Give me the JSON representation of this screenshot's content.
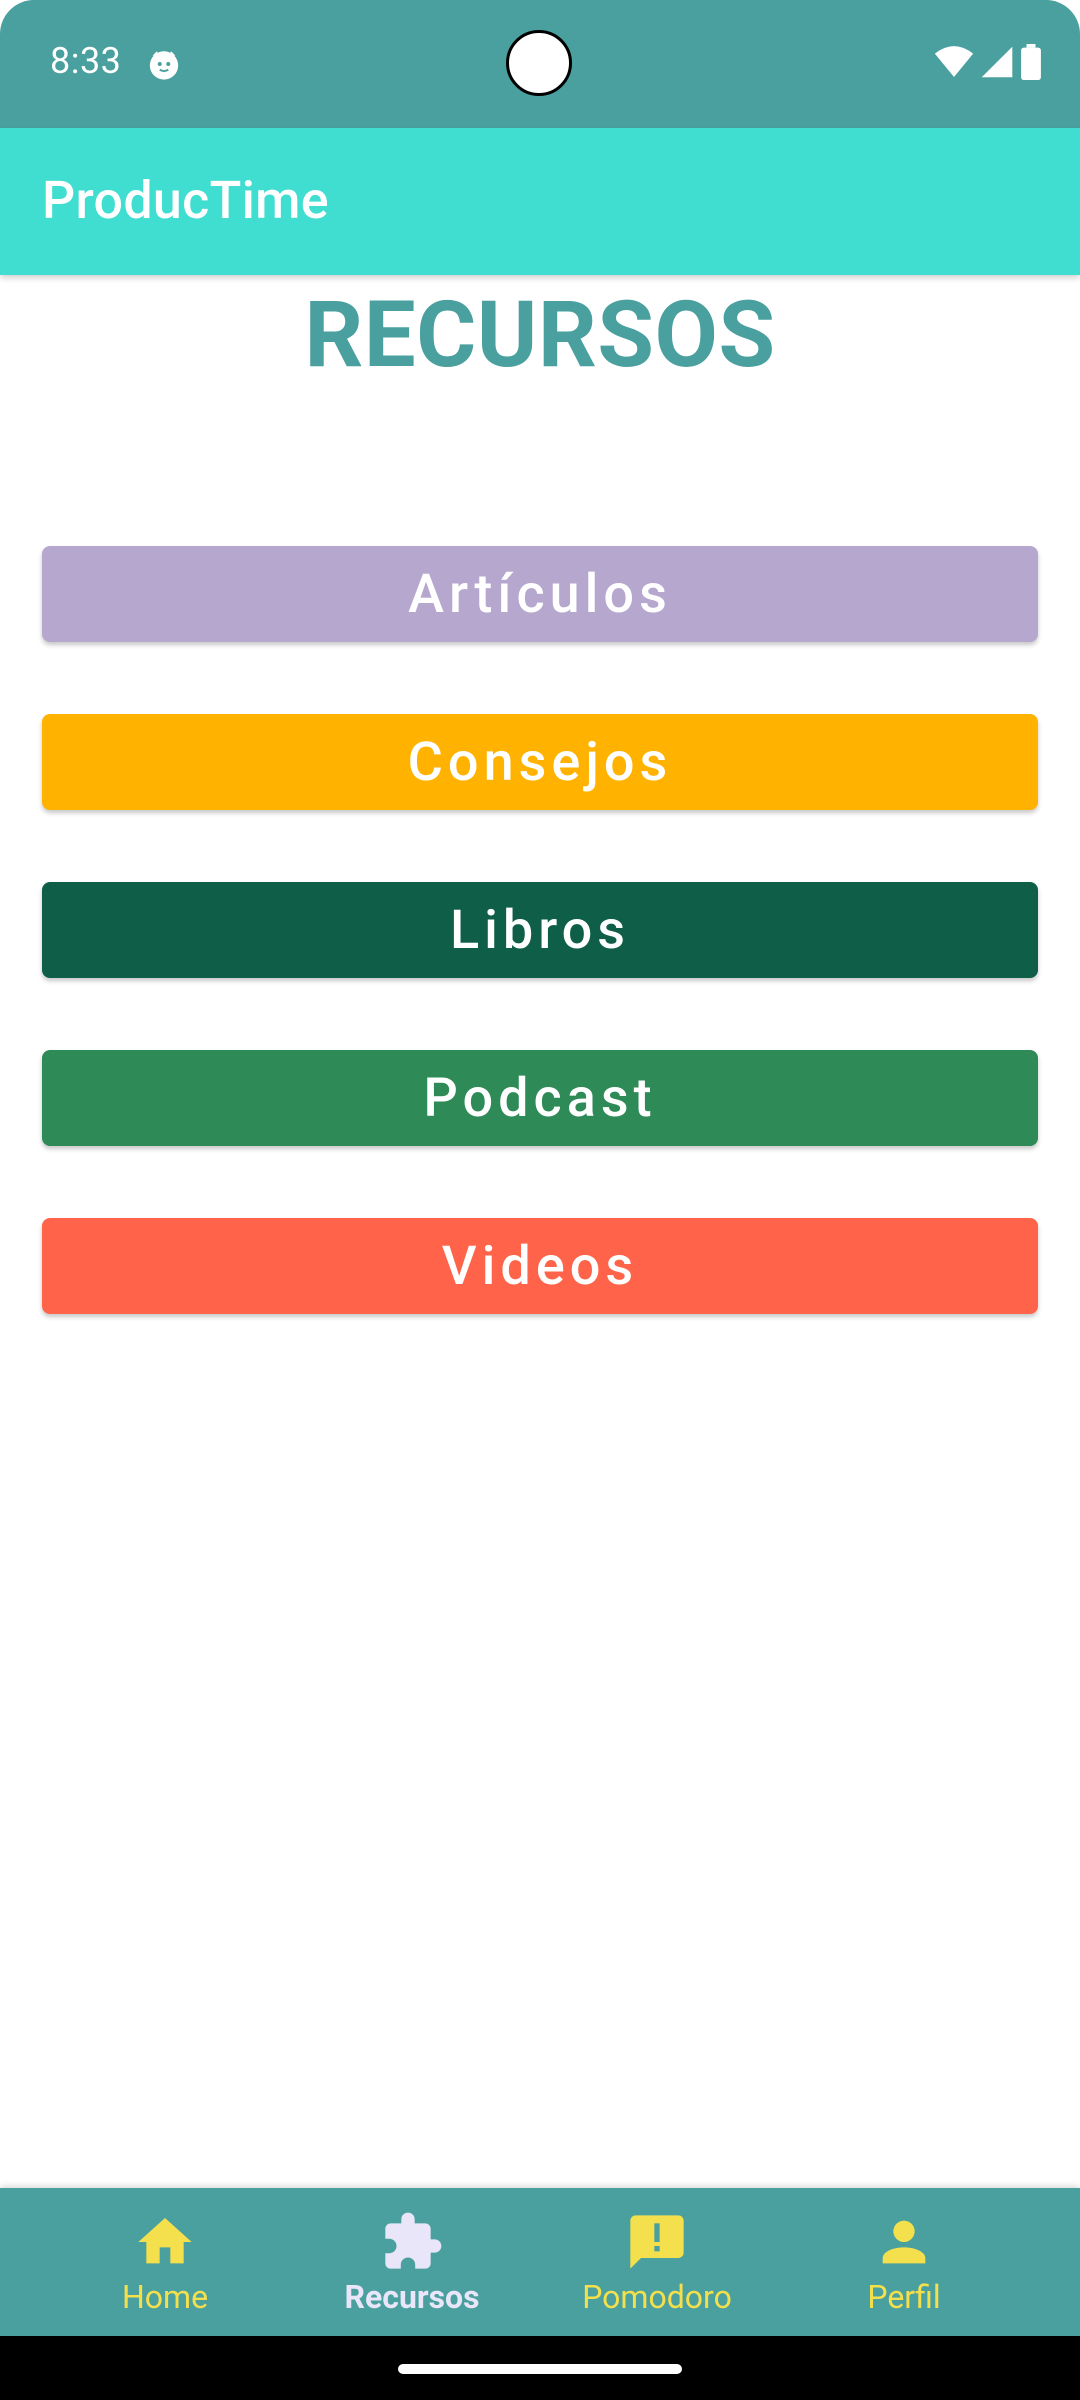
{
  "status_bar": {
    "time": "8:33"
  },
  "app_bar": {
    "title": "ProducTime"
  },
  "page": {
    "title": "RECURSOS"
  },
  "resources": [
    {
      "label": "Artículos",
      "color": "#b6a7cf"
    },
    {
      "label": "Consejos",
      "color": "#ffb300"
    },
    {
      "label": "Libros",
      "color": "#0e5e48"
    },
    {
      "label": "Podcast",
      "color": "#2e8a56"
    },
    {
      "label": "Videos",
      "color": "#ff6349"
    }
  ],
  "bottom_nav": {
    "items": [
      {
        "label": "Home",
        "icon": "home-icon",
        "active": false
      },
      {
        "label": "Recursos",
        "icon": "puzzle-icon",
        "active": true
      },
      {
        "label": "Pomodoro",
        "icon": "feedback-icon",
        "active": false
      },
      {
        "label": "Perfil",
        "icon": "person-icon",
        "active": false
      }
    ]
  },
  "colors": {
    "status_bar": "#4aa09f",
    "app_bar": "#40ddd1",
    "title": "#4aa09f",
    "nav_inactive": "#f4e04d",
    "nav_active": "#e8e6f8"
  }
}
